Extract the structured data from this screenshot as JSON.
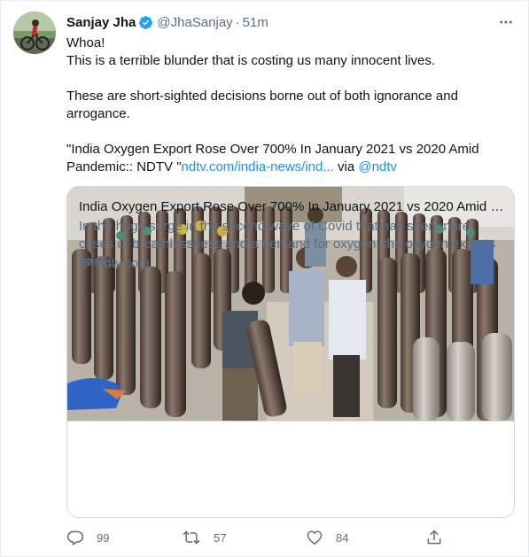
{
  "author": {
    "name": "Sanjay Jha",
    "handle": "@JhaSanjay",
    "separator": "·",
    "time": "51m",
    "avatar_icon": "avatar-cyclist"
  },
  "tweet": {
    "line1": "Whoa!",
    "line2": "This is a terrible blunder that is costing us many innocent lives.",
    "line3": "These are short-sighted decisions borne out of both ignorance and arrogance.",
    "quote_text": "\"India Oxygen Export Rose Over 700% In January 2021 vs 2020 Amid Pandemic:: NDTV \"",
    "link_text": "ndtv.com/india-news/ind...",
    "via_text": " via ",
    "mention": "@ndtv"
  },
  "card": {
    "title": "India Oxygen Export Rose Over 700% In January 2021 vs 2020 Amid Pa...",
    "description": "In the huge surge in the second wave of Covid that has seen more cases of breathlessness and a demand for oxygen, the oxygen exports from ...",
    "domain": "ndtv.com",
    "image_subject": "rows of oxygen cylinders with workers"
  },
  "actions": {
    "replies": "99",
    "retweets": "57",
    "likes": "84"
  },
  "colors": {
    "accent": "#1b95e0",
    "muted": "#5b7083",
    "text": "#0f1419",
    "verified": "#1da1f2"
  }
}
